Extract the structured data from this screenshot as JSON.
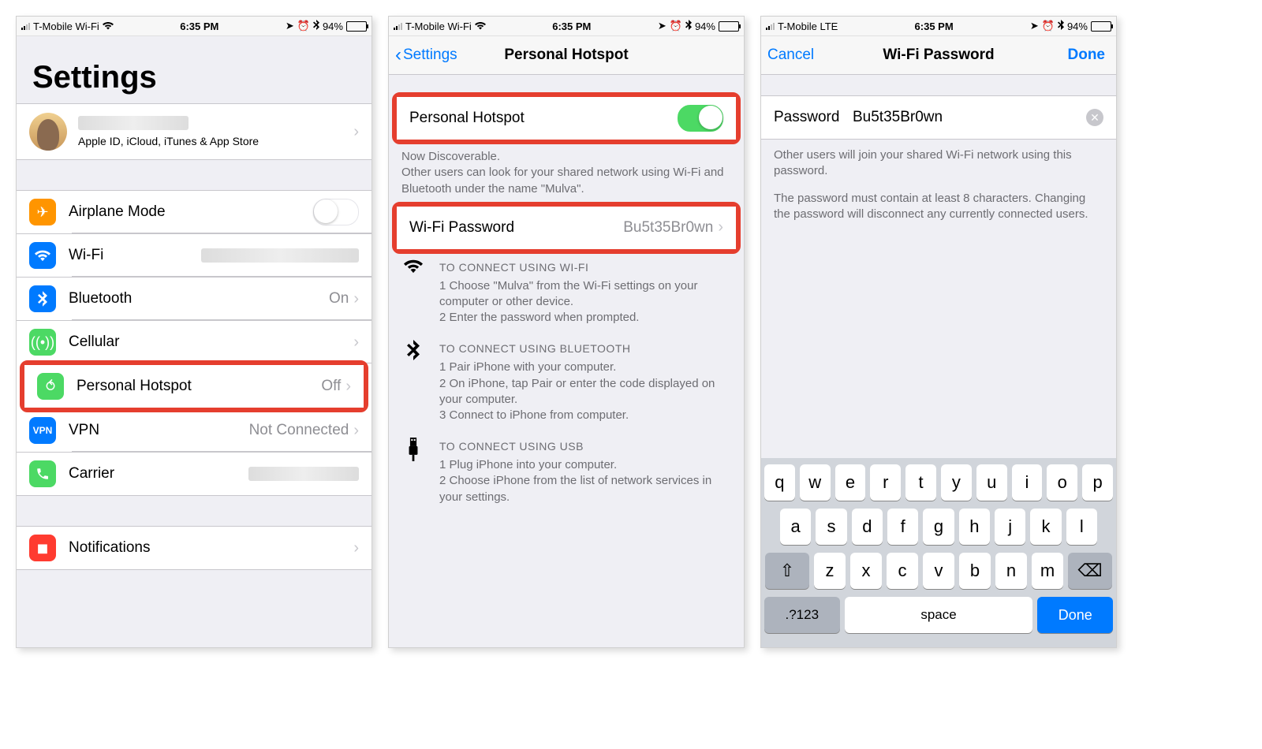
{
  "status": {
    "carrier_wifi": "T-Mobile Wi-Fi",
    "carrier_lte": "T-Mobile  LTE",
    "time": "6:35 PM",
    "battery_pct": "94%"
  },
  "screen1": {
    "title": "Settings",
    "profile_sub": "Apple ID, iCloud, iTunes & App Store",
    "rows": {
      "airplane": "Airplane Mode",
      "wifi": "Wi-Fi",
      "bluetooth": "Bluetooth",
      "bluetooth_val": "On",
      "cellular": "Cellular",
      "hotspot": "Personal Hotspot",
      "hotspot_val": "Off",
      "vpn": "VPN",
      "vpn_val": "Not Connected",
      "carrier": "Carrier",
      "notifications": "Notifications"
    }
  },
  "screen2": {
    "back": "Settings",
    "title": "Personal Hotspot",
    "toggle_label": "Personal Hotspot",
    "pw_label": "Wi-Fi Password",
    "pw_value": "Bu5t35Br0wn",
    "discover": "Now Discoverable.",
    "discover_body": "Other users can look for your shared network using Wi-Fi and Bluetooth under the name \"Mulva\".",
    "wifi_head": "TO CONNECT USING WI-FI",
    "wifi_1": "1 Choose \"Mulva\" from the Wi-Fi settings on your computer or other device.",
    "wifi_2": "2 Enter the password when prompted.",
    "bt_head": "TO CONNECT USING BLUETOOTH",
    "bt_1": "1 Pair iPhone with your computer.",
    "bt_2": "2 On iPhone, tap Pair or enter the code displayed on your computer.",
    "bt_3": "3 Connect to iPhone from computer.",
    "usb_head": "TO CONNECT USING USB",
    "usb_1": "1 Plug iPhone into your computer.",
    "usb_2": "2 Choose iPhone from the list of network services in your settings."
  },
  "screen3": {
    "cancel": "Cancel",
    "title": "Wi-Fi Password",
    "done": "Done",
    "field_label": "Password",
    "field_value": "Bu5t35Br0wn",
    "help1": "Other users will join your shared Wi-Fi network using this password.",
    "help2": "The password must contain at least 8 characters. Changing the password will disconnect any currently connected users."
  },
  "keyboard": {
    "row1": [
      "q",
      "w",
      "e",
      "r",
      "t",
      "y",
      "u",
      "i",
      "o",
      "p"
    ],
    "row2": [
      "a",
      "s",
      "d",
      "f",
      "g",
      "h",
      "j",
      "k",
      "l"
    ],
    "row3": [
      "z",
      "x",
      "c",
      "v",
      "b",
      "n",
      "m"
    ],
    "shift": "⇧",
    "del": "⌫",
    "sym": ".?123",
    "space": "space",
    "done": "Done"
  },
  "icons": {
    "airplane_color": "#ff9500",
    "wifi_color": "#007aff",
    "bt_color": "#007aff",
    "cell_color": "#4cd964",
    "hotspot_color": "#4cd964",
    "vpn_color": "#007aff",
    "carrier_color": "#4cd964",
    "notif_color": "#ff3b30"
  }
}
